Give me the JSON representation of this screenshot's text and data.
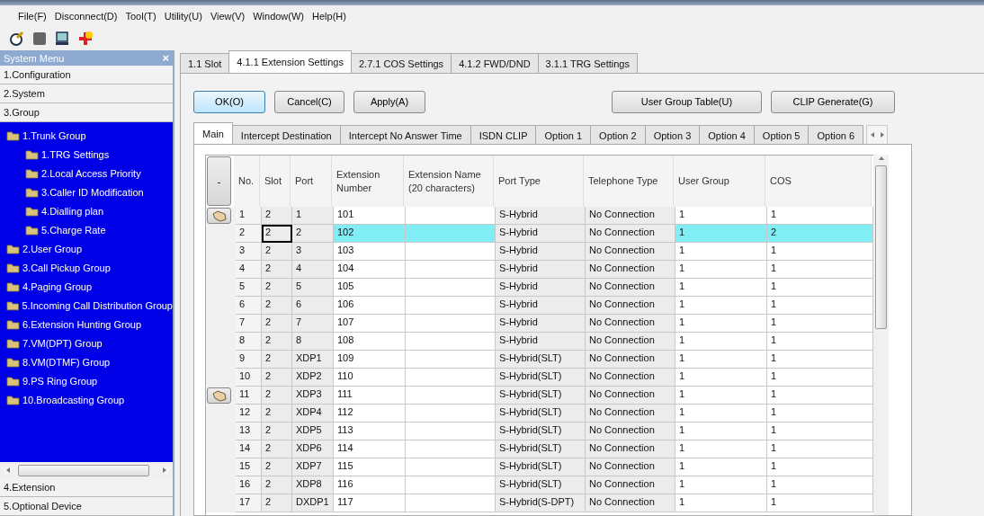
{
  "menu": [
    "File(F)",
    "Disconnect(D)",
    "Tool(T)",
    "Utility(U)",
    "View(V)",
    "Window(W)",
    "Help(H)"
  ],
  "system_menu": {
    "title": "System Menu",
    "close": "×",
    "sections_top": [
      "1.Configuration",
      "2.System",
      "3.Group"
    ],
    "tree": [
      {
        "label": "1.Trunk Group",
        "children": [
          {
            "label": "1.TRG Settings"
          },
          {
            "label": "2.Local Access Priority"
          },
          {
            "label": "3.Caller ID Modification"
          },
          {
            "label": "4.Dialling plan"
          },
          {
            "label": "5.Charge Rate"
          }
        ]
      },
      {
        "label": "2.User Group"
      },
      {
        "label": "3.Call Pickup Group"
      },
      {
        "label": "4.Paging Group"
      },
      {
        "label": "5.Incoming Call Distribution Group"
      },
      {
        "label": "6.Extension Hunting Group"
      },
      {
        "label": "7.VM(DPT) Group"
      },
      {
        "label": "8.VM(DTMF) Group"
      },
      {
        "label": "9.PS Ring Group"
      },
      {
        "label": "10.Broadcasting Group"
      }
    ],
    "sections_bottom": [
      "4.Extension",
      "5.Optional Device"
    ]
  },
  "tabs": [
    {
      "label": "1.1 Slot",
      "selected": false
    },
    {
      "label": "4.1.1 Extension Settings",
      "selected": true
    },
    {
      "label": "2.7.1 COS Settings",
      "selected": false
    },
    {
      "label": "4.1.2 FWD/DND",
      "selected": false
    },
    {
      "label": "3.1.1 TRG Settings",
      "selected": false
    }
  ],
  "buttons_left": [
    {
      "label": "OK(O)",
      "focused": true
    },
    {
      "label": "Cancel(C)",
      "focused": false
    },
    {
      "label": "Apply(A)",
      "focused": false
    }
  ],
  "buttons_right": [
    "User Group Table(U)",
    "CLIP Generate(G)"
  ],
  "subtabs": [
    {
      "label": "Main",
      "selected": true
    },
    {
      "label": "Intercept Destination",
      "selected": false
    },
    {
      "label": "Intercept No Answer Time",
      "selected": false
    },
    {
      "label": "ISDN CLIP",
      "selected": false
    },
    {
      "label": "Option 1",
      "selected": false
    },
    {
      "label": "Option 2",
      "selected": false
    },
    {
      "label": "Option 3",
      "selected": false
    },
    {
      "label": "Option 4",
      "selected": false
    },
    {
      "label": "Option 5",
      "selected": false
    },
    {
      "label": "Option 6",
      "selected": false
    }
  ],
  "table": {
    "corner": "-",
    "columns": [
      "No.",
      "Slot",
      "Port",
      "Extension Number",
      "Extension Name (20 characters)",
      "Port Type",
      "Telephone Type",
      "User Group",
      "COS"
    ],
    "rows": [
      {
        "marked": true,
        "selected": false,
        "cells": [
          "1",
          "2",
          "1",
          "101",
          "",
          "S-Hybrid",
          "No Connection",
          "1",
          "1"
        ]
      },
      {
        "marked": false,
        "selected": true,
        "cells": [
          "2",
          "2",
          "2",
          "102",
          "",
          "S-Hybrid",
          "No Connection",
          "1",
          "2"
        ]
      },
      {
        "marked": false,
        "selected": false,
        "cells": [
          "3",
          "2",
          "3",
          "103",
          "",
          "S-Hybrid",
          "No Connection",
          "1",
          "1"
        ]
      },
      {
        "marked": false,
        "selected": false,
        "cells": [
          "4",
          "2",
          "4",
          "104",
          "",
          "S-Hybrid",
          "No Connection",
          "1",
          "1"
        ]
      },
      {
        "marked": false,
        "selected": false,
        "cells": [
          "5",
          "2",
          "5",
          "105",
          "",
          "S-Hybrid",
          "No Connection",
          "1",
          "1"
        ]
      },
      {
        "marked": false,
        "selected": false,
        "cells": [
          "6",
          "2",
          "6",
          "106",
          "",
          "S-Hybrid",
          "No Connection",
          "1",
          "1"
        ]
      },
      {
        "marked": false,
        "selected": false,
        "cells": [
          "7",
          "2",
          "7",
          "107",
          "",
          "S-Hybrid",
          "No Connection",
          "1",
          "1"
        ]
      },
      {
        "marked": false,
        "selected": false,
        "cells": [
          "8",
          "2",
          "8",
          "108",
          "",
          "S-Hybrid",
          "No Connection",
          "1",
          "1"
        ]
      },
      {
        "marked": false,
        "selected": false,
        "cells": [
          "9",
          "2",
          "XDP1",
          "109",
          "",
          "S-Hybrid(SLT)",
          "No Connection",
          "1",
          "1"
        ]
      },
      {
        "marked": false,
        "selected": false,
        "cells": [
          "10",
          "2",
          "XDP2",
          "110",
          "",
          "S-Hybrid(SLT)",
          "No Connection",
          "1",
          "1"
        ]
      },
      {
        "marked": true,
        "selected": false,
        "cells": [
          "11",
          "2",
          "XDP3",
          "111",
          "",
          "S-Hybrid(SLT)",
          "No Connection",
          "1",
          "1"
        ]
      },
      {
        "marked": false,
        "selected": false,
        "cells": [
          "12",
          "2",
          "XDP4",
          "112",
          "",
          "S-Hybrid(SLT)",
          "No Connection",
          "1",
          "1"
        ]
      },
      {
        "marked": false,
        "selected": false,
        "cells": [
          "13",
          "2",
          "XDP5",
          "113",
          "",
          "S-Hybrid(SLT)",
          "No Connection",
          "1",
          "1"
        ]
      },
      {
        "marked": false,
        "selected": false,
        "cells": [
          "14",
          "2",
          "XDP6",
          "114",
          "",
          "S-Hybrid(SLT)",
          "No Connection",
          "1",
          "1"
        ]
      },
      {
        "marked": false,
        "selected": false,
        "cells": [
          "15",
          "2",
          "XDP7",
          "115",
          "",
          "S-Hybrid(SLT)",
          "No Connection",
          "1",
          "1"
        ]
      },
      {
        "marked": false,
        "selected": false,
        "cells": [
          "16",
          "2",
          "XDP8",
          "116",
          "",
          "S-Hybrid(SLT)",
          "No Connection",
          "1",
          "1"
        ]
      },
      {
        "marked": false,
        "selected": false,
        "cells": [
          "17",
          "2",
          "DXDP1",
          "117",
          "",
          "S-Hybrid(S-DPT)",
          "No Connection",
          "1",
          "1"
        ]
      }
    ]
  }
}
